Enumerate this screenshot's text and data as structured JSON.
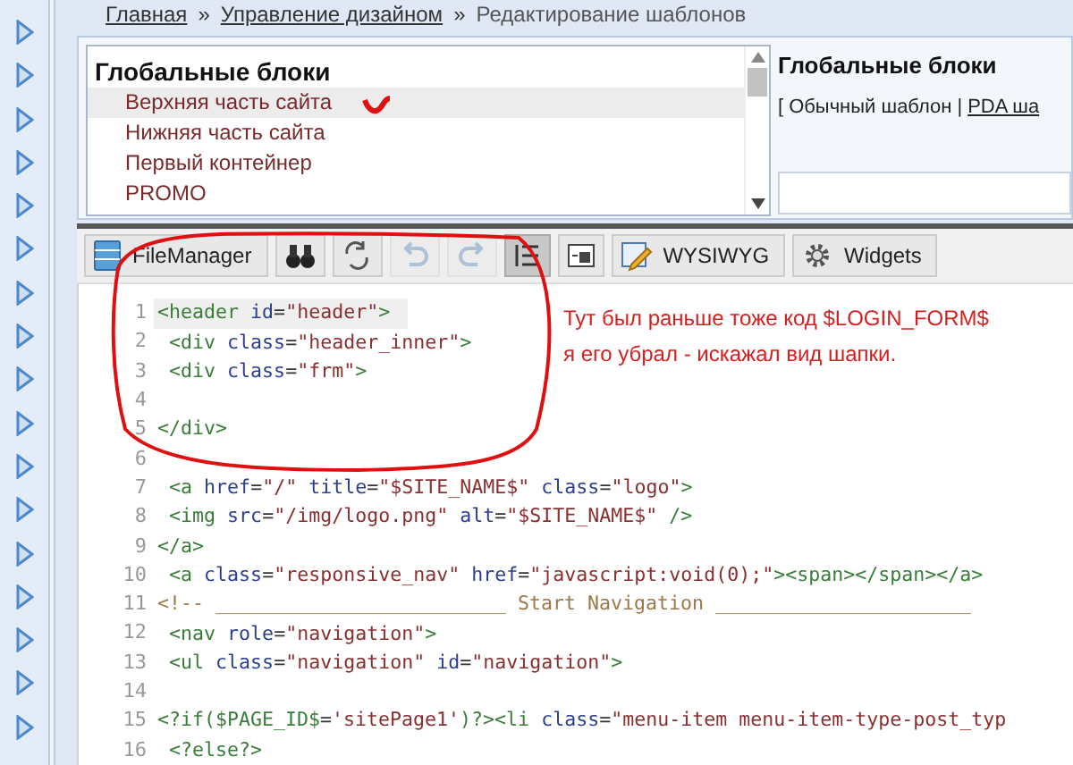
{
  "breadcrumb": {
    "separator": "»",
    "items": [
      {
        "label": "Главная",
        "link": true
      },
      {
        "label": "Управление дизайном",
        "link": true
      },
      {
        "label": "Редактирование шаблонов",
        "link": false
      }
    ]
  },
  "blocks_list": {
    "heading": "Глобальные блоки",
    "items": [
      {
        "label": "Верхняя часть сайта",
        "selected": true
      },
      {
        "label": "Нижняя часть сайта",
        "selected": false
      },
      {
        "label": "Первый контейнер",
        "selected": false
      },
      {
        "label": "PROMO",
        "selected": false
      }
    ]
  },
  "preview": {
    "heading": "Глобальные блоки",
    "open_bracket": "[",
    "separator": "|",
    "options": [
      {
        "label": "Обычный шаблон",
        "selected": true
      },
      {
        "label": "PDA ша",
        "selected": false
      }
    ]
  },
  "toolbar": [
    {
      "kind": "filemanager",
      "label": "FileManager",
      "disabled": false,
      "on": false
    },
    {
      "kind": "search",
      "disabled": false,
      "on": false
    },
    {
      "kind": "replace",
      "disabled": false,
      "on": false
    },
    {
      "kind": "undo",
      "disabled": true,
      "on": false
    },
    {
      "kind": "redo",
      "disabled": true,
      "on": false
    },
    {
      "kind": "line-numbers",
      "disabled": false,
      "on": true
    },
    {
      "kind": "preview",
      "disabled": false,
      "on": false
    },
    {
      "kind": "wysiwyg",
      "label": "WYSIWYG",
      "disabled": false,
      "on": false
    },
    {
      "kind": "widgets",
      "label": "Widgets",
      "disabled": false,
      "on": false
    }
  ],
  "editor": {
    "lines": [
      {
        "number": "1",
        "active": true,
        "kind": "code",
        "text": "<header id=\"header\">"
      },
      {
        "number": "2",
        "active": false,
        "kind": "code",
        "text": " <div class=\"header_inner\">"
      },
      {
        "number": "3",
        "active": false,
        "kind": "code",
        "text": " <div class=\"frm\">"
      },
      {
        "number": "4",
        "active": false
      },
      {
        "number": "5",
        "active": false,
        "kind": "code",
        "text": "</div>"
      },
      {
        "number": "6",
        "active": false
      },
      {
        "number": "7",
        "active": false,
        "kind": "code",
        "text": " <a href=\"/\" title=\"$SITE_NAME$\" class=\"logo\">"
      },
      {
        "number": "8",
        "active": false,
        "kind": "code",
        "text": " <img src=\"/img/logo.png\" alt=\"$SITE_NAME$\" />"
      },
      {
        "number": "9",
        "active": false,
        "kind": "code",
        "text": "</a>"
      },
      {
        "number": "10",
        "active": false,
        "kind": "code",
        "text": " <a class=\"responsive_nav\" href=\"javascript:void(0);\"><span></span></a>"
      },
      {
        "number": "11",
        "active": false,
        "kind": "comment",
        "text": "<!-- _________________________ Start Navigation ______________________"
      },
      {
        "number": "12",
        "active": false,
        "kind": "code",
        "text": " <nav role=\"navigation\">"
      },
      {
        "number": "13",
        "active": false,
        "kind": "code",
        "text": " <ul class=\"navigation\" id=\"navigation\">"
      },
      {
        "number": "14",
        "active": false
      },
      {
        "number": "15",
        "active": false,
        "kind": "code",
        "text": "<?if($PAGE_ID$='sitePage1')?><li class=\"menu-item menu-item-type-post_typ"
      },
      {
        "number": "16",
        "active": false,
        "kind": "code",
        "text": " <?else?>"
      }
    ]
  },
  "annotation": {
    "lines": [
      "Тут был раньше тоже код $LOGIN_FORM$",
      "я его убрал - искажал вид шапки."
    ]
  }
}
